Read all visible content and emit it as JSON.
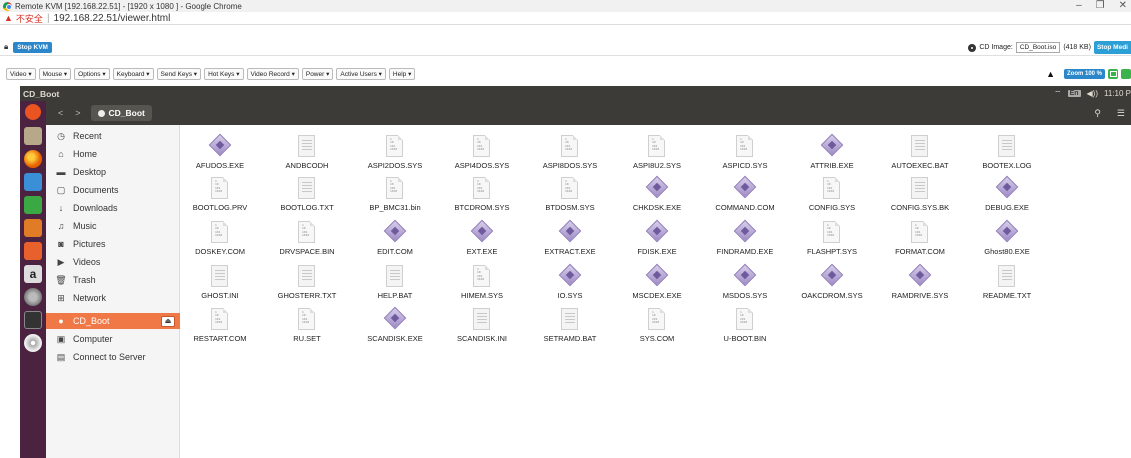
{
  "browser": {
    "title": "Remote KVM [192.168.22.51] - [1920 x 1080 ] - Google Chrome",
    "insecure_label": "不安全",
    "url": "192.168.22.51/viewer.html"
  },
  "kvm_toolbar": {
    "stop_kvm": "Stop KVM",
    "cd_image_label": "CD Image:",
    "cd_image_value": "CD_Boot.iso",
    "cd_image_size": "(418 KB)",
    "stop_media": "Stop Medi",
    "menus": [
      "Video ▾",
      "Mouse ▾",
      "Options ▾",
      "Keyboard ▾",
      "Send Keys ▾",
      "Hot Keys ▾",
      "Video Record ▾",
      "Power ▾",
      "Active Users ▾",
      "Help ▾"
    ],
    "zoom_label": "Zoom 100 %"
  },
  "ubuntu": {
    "topbar_title": "CD_Boot",
    "lang": "En",
    "volume": "◀))",
    "clock": "11:10 P",
    "path_button": "CD_Boot"
  },
  "sidebar": {
    "items": [
      {
        "icon": "◷",
        "label": "Recent"
      },
      {
        "icon": "⌂",
        "label": "Home"
      },
      {
        "icon": "▬",
        "label": "Desktop"
      },
      {
        "icon": "▢",
        "label": "Documents"
      },
      {
        "icon": "↓",
        "label": "Downloads"
      },
      {
        "icon": "♫",
        "label": "Music"
      },
      {
        "icon": "◙",
        "label": "Pictures"
      },
      {
        "icon": "▶",
        "label": "Videos"
      },
      {
        "icon": "🗑",
        "label": "Trash"
      },
      {
        "icon": "⊞",
        "label": "Network"
      },
      {
        "icon": "●",
        "label": "CD_Boot"
      },
      {
        "icon": "▣",
        "label": "Computer"
      },
      {
        "icon": "▤",
        "label": "Connect to Server"
      }
    ]
  },
  "files": [
    {
      "name": "AFUDOS.EXE",
      "kind": "exe"
    },
    {
      "name": "ANDBCODH",
      "kind": "txt"
    },
    {
      "name": "ASPI2DOS.SYS",
      "kind": "bin"
    },
    {
      "name": "ASPI4DOS.SYS",
      "kind": "bin"
    },
    {
      "name": "ASPI8DOS.SYS",
      "kind": "bin"
    },
    {
      "name": "ASPI8U2.SYS",
      "kind": "bin"
    },
    {
      "name": "ASPICD.SYS",
      "kind": "bin"
    },
    {
      "name": "ATTRIB.EXE",
      "kind": "exe"
    },
    {
      "name": "AUTOEXEC.BAT",
      "kind": "txt"
    },
    {
      "name": "BOOTEX.LOG",
      "kind": "txt"
    },
    {
      "name": "BOOTLOG.PRV",
      "kind": "bin"
    },
    {
      "name": "BOOTLOG.TXT",
      "kind": "txt"
    },
    {
      "name": "BP_BMC31.bin",
      "kind": "bin"
    },
    {
      "name": "BTCDROM.SYS",
      "kind": "bin"
    },
    {
      "name": "BTDOSM.SYS",
      "kind": "bin"
    },
    {
      "name": "CHKDSK.EXE",
      "kind": "exe"
    },
    {
      "name": "COMMAND.COM",
      "kind": "exe"
    },
    {
      "name": "CONFIG.SYS",
      "kind": "bin"
    },
    {
      "name": "CONFIG.SYS.BK",
      "kind": "txt"
    },
    {
      "name": "DEBUG.EXE",
      "kind": "exe"
    },
    {
      "name": "DOSKEY.COM",
      "kind": "bin"
    },
    {
      "name": "DRVSPACE.BIN",
      "kind": "bin"
    },
    {
      "name": "EDIT.COM",
      "kind": "exe"
    },
    {
      "name": "EXT.EXE",
      "kind": "exe"
    },
    {
      "name": "EXTRACT.EXE",
      "kind": "exe"
    },
    {
      "name": "FDISK.EXE",
      "kind": "exe"
    },
    {
      "name": "FINDRAMD.EXE",
      "kind": "exe"
    },
    {
      "name": "FLASHPT.SYS",
      "kind": "bin"
    },
    {
      "name": "FORMAT.COM",
      "kind": "bin"
    },
    {
      "name": "Ghost80.EXE",
      "kind": "exe"
    },
    {
      "name": "GHOST.INI",
      "kind": "txt"
    },
    {
      "name": "GHOSTERR.TXT",
      "kind": "txt"
    },
    {
      "name": "HELP.BAT",
      "kind": "txt"
    },
    {
      "name": "HIMEM.SYS",
      "kind": "bin"
    },
    {
      "name": "IO.SYS",
      "kind": "exe"
    },
    {
      "name": "MSCDEX.EXE",
      "kind": "exe"
    },
    {
      "name": "MSDOS.SYS",
      "kind": "exe"
    },
    {
      "name": "OAKCDROM.SYS",
      "kind": "exe"
    },
    {
      "name": "RAMDRIVE.SYS",
      "kind": "exe"
    },
    {
      "name": "README.TXT",
      "kind": "txt"
    },
    {
      "name": "RESTART.COM",
      "kind": "bin"
    },
    {
      "name": "RU.SET",
      "kind": "bin"
    },
    {
      "name": "SCANDISK.EXE",
      "kind": "exe"
    },
    {
      "name": "SCANDISK.INI",
      "kind": "txt"
    },
    {
      "name": "SETRAMD.BAT",
      "kind": "txt"
    },
    {
      "name": "SYS.COM",
      "kind": "bin"
    },
    {
      "name": "U-BOOT.BIN",
      "kind": "bin"
    }
  ]
}
